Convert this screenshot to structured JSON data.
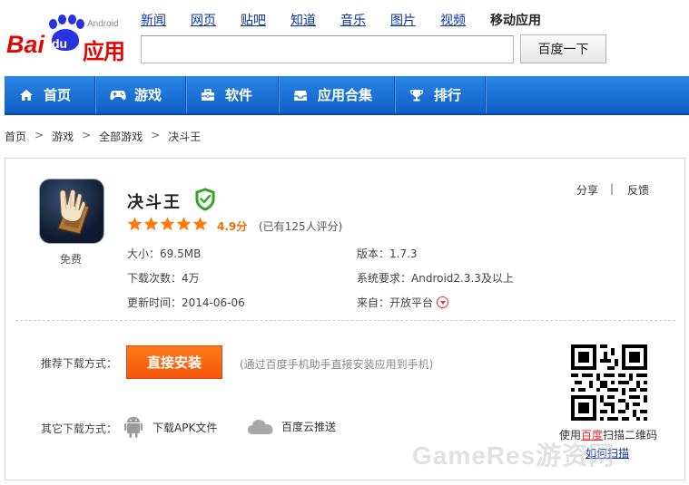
{
  "logo": {
    "text_bai": "Bai",
    "text_du": "du",
    "text_app": "应用",
    "sub": "Android"
  },
  "topnav": {
    "links": [
      "新闻",
      "网页",
      "贴吧",
      "知道",
      "音乐",
      "图片",
      "视频"
    ],
    "current": "移动应用"
  },
  "search": {
    "value": "",
    "button_label": "百度一下"
  },
  "menu": {
    "items": [
      {
        "label": "首页",
        "icon": "home-icon"
      },
      {
        "label": "游戏",
        "icon": "gamepad-icon"
      },
      {
        "label": "软件",
        "icon": "toolbox-icon"
      },
      {
        "label": "应用合集",
        "icon": "inbox-icon"
      },
      {
        "label": "排行",
        "icon": "trophy-icon"
      }
    ]
  },
  "breadcrumb": {
    "items": [
      "首页",
      "游戏",
      "全部游戏",
      "决斗王"
    ],
    "separator": ">"
  },
  "app": {
    "name": "决斗王",
    "price": "免费",
    "stars": 5,
    "score": "4.9分",
    "rating_count": "(已有125人评分)",
    "size_label": "大小：",
    "size": "69.5MB",
    "downloads_label": "下载次数：",
    "downloads": "4万",
    "updated_label": "更新时间：",
    "updated": "2014-06-06",
    "version_label": "版本：",
    "version": "1.7.3",
    "requirement_label": "系统要求：",
    "requirement": "Android2.3.3及以上",
    "source_label": "来自：",
    "source": "开放平台"
  },
  "actions": {
    "share": "分享",
    "separator": "|",
    "feedback": "反馈"
  },
  "download": {
    "recommended_label": "推荐下载方式：",
    "install_button": "直接安装",
    "install_note": "(通过百度手机助手直接安装应用到手机)",
    "other_label": "其它下载方式：",
    "apk_label": "下载APK文件",
    "cloud_label": "百度云推送",
    "qr_caption_pre": "使用",
    "qr_caption_link": "百度",
    "qr_caption_post": "扫描二维码",
    "qr_how": "如何扫描"
  },
  "watermark": "GameRes游资网",
  "colors": {
    "menu_blue": "#1a6fd8",
    "install_orange": "#f4600c",
    "logo_red": "#e10601",
    "logo_blue": "#2932e1"
  }
}
